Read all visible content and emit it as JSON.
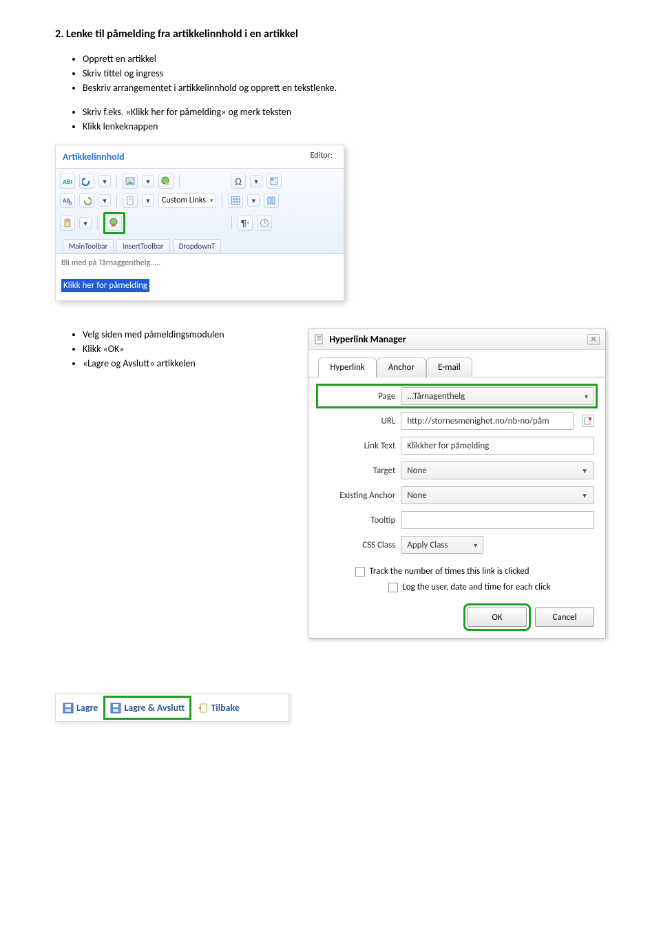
{
  "heading": "2. Lenke til påmelding fra artikkelinnhold i en artikkel",
  "list1": [
    "Opprett en artikkel",
    "Skriv tittel og ingress",
    "Beskriv arrangementet i artikkelinnhold og opprett en tekstlenke."
  ],
  "list2": [
    "Skriv f.eks. «Klikk her for påmelding» og merk teksten",
    "Klikk lenkeknappen"
  ],
  "list3": [
    "Velg siden med påmeldingsmodulen",
    "Klikk «OK»",
    "«Lagre og Avslutt» artikkelen"
  ],
  "editor": {
    "section_title": "Artikkelinnhold",
    "label": "Editor:",
    "custom_links": "Custom Links",
    "tab1": "MainToolbar",
    "tab2": "InsertToolbar",
    "tab3": "DropdownT",
    "content_line1": "Bli med på Tårnaggenthelg.....",
    "content_selected": "Klikk her for påmelding"
  },
  "dialog": {
    "title": "Hyperlink Manager",
    "tab_hyperlink": "Hyperlink",
    "tab_anchor": "Anchor",
    "tab_email": "E-mail",
    "page_label": "Page",
    "page_value": "...Tårnagenthelg",
    "url_label": "URL",
    "url_value": "http://stornesmenighet.no/nb-no/påm",
    "linktext_label": "Link Text",
    "linktext_value": "Klikkher for påmelding",
    "target_label": "Target",
    "target_value": "None",
    "anchor_label": "Existing Anchor",
    "anchor_value": "None",
    "tooltip_label": "Tooltip",
    "tooltip_value": "",
    "css_label": "CSS Class",
    "css_value": "Apply Class",
    "track_label": "Track the number of times this link is clicked",
    "log_label": "Log the user, date and time for each click",
    "ok": "OK",
    "cancel": "Cancel"
  },
  "savebar": {
    "lagre": "Lagre",
    "lagre_avslutt": "Lagre & Avslutt",
    "tilbake": "Tilbake"
  }
}
